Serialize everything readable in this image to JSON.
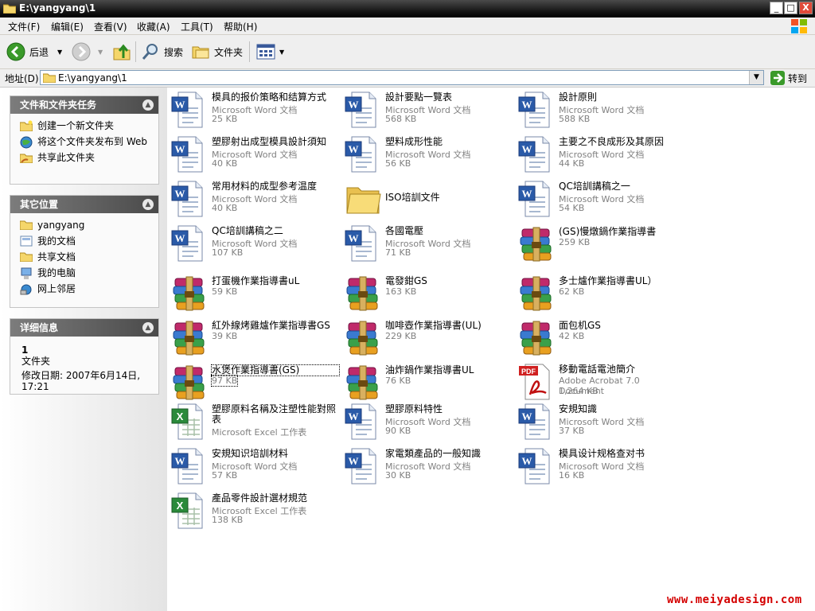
{
  "window": {
    "title": "E:\\yangyang\\1",
    "minimize": "_",
    "maximize": "□",
    "close": "X"
  },
  "menu": [
    "文件(F)",
    "编辑(E)",
    "查看(V)",
    "收藏(A)",
    "工具(T)",
    "帮助(H)"
  ],
  "toolbar": {
    "back": "后退",
    "search": "搜索",
    "folders": "文件夹"
  },
  "address": {
    "label": "地址(D)",
    "path": "E:\\yangyang\\1",
    "go": "转到"
  },
  "tasks": {
    "title": "文件和文件夹任务",
    "items": [
      "创建一个新文件夹",
      "将这个文件夹发布到 Web",
      "共享此文件夹"
    ]
  },
  "places": {
    "title": "其它位置",
    "items": [
      "yangyang",
      "我的文档",
      "共享文档",
      "我的电脑",
      "网上邻居"
    ]
  },
  "details": {
    "title": "详细信息",
    "count": "1",
    "kind": "文件夹",
    "modified": "修改日期: 2007年6月14日,",
    "time": "17:21"
  },
  "files": [
    {
      "name": "模具的报价策略和结算方式",
      "type": "Microsoft Word 文档",
      "size": "25 KB",
      "icon": "word-icon"
    },
    {
      "name": "設計要點一覽表",
      "type": "Microsoft Word 文档",
      "size": "568 KB",
      "icon": "word-icon"
    },
    {
      "name": "設計原則",
      "type": "Microsoft Word 文档",
      "size": "588 KB",
      "icon": "word-icon"
    },
    {
      "name": "塑膠射出成型模具設計須知",
      "type": "Microsoft Word 文档",
      "size": "40 KB",
      "icon": "word-icon"
    },
    {
      "name": "塑料成形性能",
      "type": "Microsoft Word 文档",
      "size": "56 KB",
      "icon": "word-icon"
    },
    {
      "name": "主要之不良成形及其原因",
      "type": "Microsoft Word 文档",
      "size": "44 KB",
      "icon": "word-icon"
    },
    {
      "name": "常用材料的成型参考温度",
      "type": "Microsoft Word 文档",
      "size": "40 KB",
      "icon": "word-icon"
    },
    {
      "name": "ISO培訓文件",
      "type": "",
      "size": "",
      "icon": "folder-icon"
    },
    {
      "name": "QC培訓講稿之一",
      "type": "Microsoft Word 文档",
      "size": "54 KB",
      "icon": "word-icon"
    },
    {
      "name": "QC培訓講稿之二",
      "type": "Microsoft Word 文档",
      "size": "107 KB",
      "icon": "word-icon"
    },
    {
      "name": "各國電壓",
      "type": "Microsoft Word 文档",
      "size": "71 KB",
      "icon": "word-icon"
    },
    {
      "name": "(GS)慢燉鍋作業指導書",
      "type": "",
      "size": "259 KB",
      "icon": "rar-icon"
    },
    {
      "name": "打蛋機作業指導書uL",
      "type": "",
      "size": "59 KB",
      "icon": "rar-icon"
    },
    {
      "name": "電發鉗GS",
      "type": "",
      "size": "163 KB",
      "icon": "rar-icon"
    },
    {
      "name": "多士爐作業指導書UL）",
      "type": "",
      "size": "62 KB",
      "icon": "rar-icon"
    },
    {
      "name": "紅外線烤雞爐作業指導書GS",
      "type": "",
      "size": "39 KB",
      "icon": "rar-icon"
    },
    {
      "name": "咖啡壺作業指導書(UL)",
      "type": "",
      "size": "229 KB",
      "icon": "rar-icon"
    },
    {
      "name": "面包机GS",
      "type": "",
      "size": "42 KB",
      "icon": "rar-icon"
    },
    {
      "name": "水煲作業指導書(GS)",
      "type": "",
      "size": "97 KB",
      "icon": "rar-icon"
    },
    {
      "name": "油炸鍋作業指導書UL",
      "type": "",
      "size": "76 KB",
      "icon": "rar-icon"
    },
    {
      "name": "移動電話電池簡介",
      "type": "Adobe Acrobat 7.0 Document",
      "size": "1,264 KB",
      "icon": "pdf-icon"
    },
    {
      "name": "塑膠原料名稱及注塑性能對照表",
      "type": "Microsoft Excel 工作表",
      "size": "",
      "icon": "excel-icon"
    },
    {
      "name": "塑膠原料特性",
      "type": "Microsoft Word 文档",
      "size": "90 KB",
      "icon": "word-icon"
    },
    {
      "name": "安規知識",
      "type": "Microsoft Word 文档",
      "size": "37 KB",
      "icon": "word-icon"
    },
    {
      "name": "安規知识培訓材料",
      "type": "Microsoft Word 文档",
      "size": "57 KB",
      "icon": "word-icon"
    },
    {
      "name": "家電類產品的一般知識",
      "type": "Microsoft Word 文档",
      "size": "30 KB",
      "icon": "word-icon"
    },
    {
      "name": "模具设计规格查对书",
      "type": "Microsoft Word 文档",
      "size": "16 KB",
      "icon": "word-icon"
    },
    {
      "name": "產品零件設計選材規范",
      "type": "Microsoft Excel 工作表",
      "size": "138 KB",
      "icon": "excel-icon"
    }
  ],
  "watermark": "www.meiyadesign.com"
}
